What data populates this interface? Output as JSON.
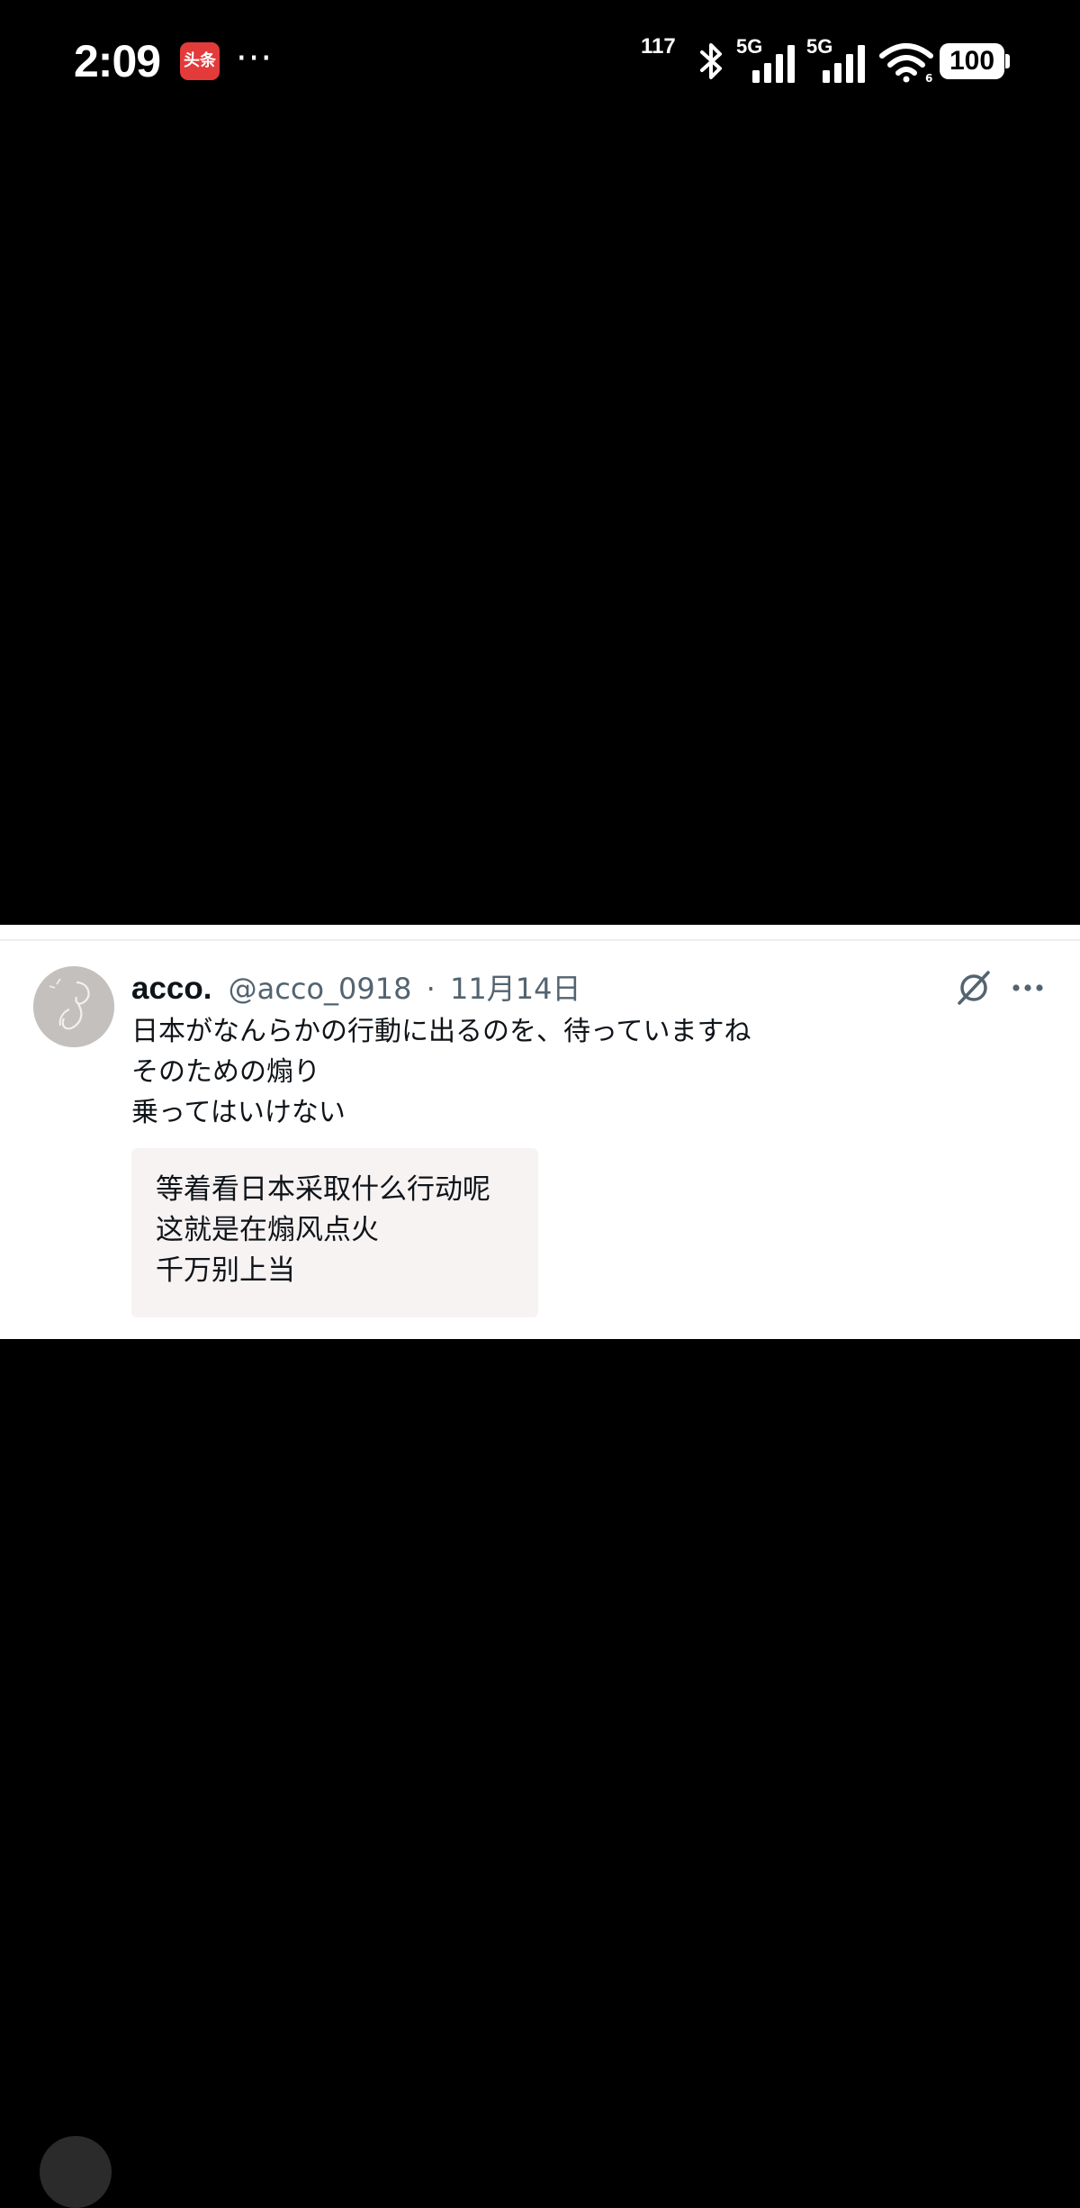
{
  "status_bar": {
    "time": "2:09",
    "app_badge": "头条",
    "more_dots": "···",
    "net_speed": "117",
    "signal_1": "5G",
    "signal_2": "5G",
    "battery": "100",
    "icons": [
      "bluetooth-icon",
      "signal-icon",
      "wifi-icon",
      "battery-icon"
    ]
  },
  "tweet": {
    "author_name": "acco.",
    "author_handle": "@acco_0918",
    "separator": "·",
    "date": "11月14日",
    "text_lines": [
      "日本がなんらかの行動に出るのを、待っていますね",
      "そのための煽り",
      "乗ってはいけない"
    ],
    "translation_lines": [
      "等着看日本采取什么行动呢",
      "这就是在煽风点火",
      "千万别上当"
    ],
    "icons": [
      "grok-icon",
      "more-icon",
      "avatar"
    ]
  },
  "colors": {
    "background": "#000000",
    "card": "#ffffff",
    "text_primary": "#0f1419",
    "text_secondary": "#536471",
    "translation_bg": "#f7f3f3",
    "app_badge": "#e33a3a"
  }
}
